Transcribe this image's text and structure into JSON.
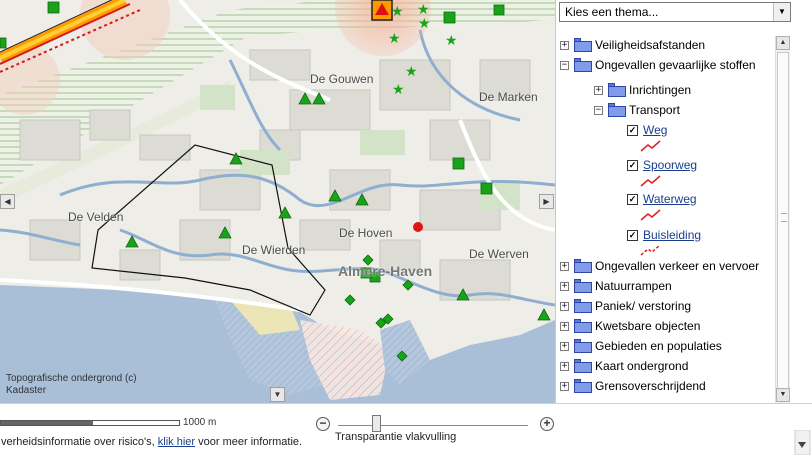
{
  "map": {
    "places": [
      {
        "id": "gouwen",
        "label": "De Gouwen"
      },
      {
        "id": "marken",
        "label": "De Marken"
      },
      {
        "id": "velden",
        "label": "De Velden"
      },
      {
        "id": "wierden",
        "label": "De Wierden"
      },
      {
        "id": "hoven",
        "label": "De Hoven"
      },
      {
        "id": "werven",
        "label": "De Werven"
      },
      {
        "id": "haven",
        "label": "Almere-Haven"
      }
    ],
    "attribution": "Topografische ondergrond (c) Kadaster",
    "colors": {
      "marker": "#1aa31a",
      "incident": "#e01515",
      "risk_zone": "#f7b8a0",
      "water": "#7aa2c9",
      "boundary": "#000000"
    }
  },
  "panel": {
    "theme_select": {
      "value": "Kies een thema...",
      "arrow_icon": "chevron-down-icon"
    },
    "tree": [
      {
        "id": "veiligheid",
        "label": "Veiligheidsafstanden",
        "expander": "+",
        "level": 0
      },
      {
        "id": "ongevallen_gev",
        "label": "Ongevallen gevaarlijke stoffen",
        "expander": "−",
        "level": 0
      },
      {
        "id": "inrichtingen",
        "label": "Inrichtingen",
        "expander": "+",
        "level": 1
      },
      {
        "id": "transport",
        "label": "Transport",
        "expander": "−",
        "level": 1
      },
      {
        "id": "ongevallen_verkeer",
        "label": "Ongevallen verkeer en vervoer",
        "expander": "+",
        "level": 0
      },
      {
        "id": "natuur",
        "label": "Natuurrampen",
        "expander": "+",
        "level": 0
      },
      {
        "id": "paniek",
        "label": "Paniek/ verstoring",
        "expander": "+",
        "level": 0
      },
      {
        "id": "kwetsbaar",
        "label": "Kwetsbare objecten",
        "expander": "+",
        "level": 0
      },
      {
        "id": "gebieden",
        "label": "Gebieden en populaties",
        "expander": "+",
        "level": 0
      },
      {
        "id": "kaart",
        "label": "Kaart ondergrond",
        "expander": "+",
        "level": 0
      },
      {
        "id": "grens",
        "label": "Grensoverschrijdend",
        "expander": "+",
        "level": 0
      }
    ],
    "layers": [
      {
        "id": "weg",
        "label": "Weg",
        "checked": true,
        "color": "#e02020",
        "style": "solid"
      },
      {
        "id": "spoorweg",
        "label": "Spoorweg",
        "checked": true,
        "color": "#e02020",
        "style": "solid"
      },
      {
        "id": "waterweg",
        "label": "Waterweg",
        "checked": true,
        "color": "#e02020",
        "style": "solid"
      },
      {
        "id": "buisleiding",
        "label": "Buisleiding",
        "checked": true,
        "color": "#e02020",
        "style": "dashed"
      }
    ],
    "check_mark": "✓"
  },
  "bottom": {
    "scale_label": "1000 m",
    "zoom_out": "−",
    "zoom_in": "+",
    "slider_label": "Transparantie vlakvulling",
    "slider_value": 0.2,
    "footer_prefix": "verheidsinformatie over risico's, ",
    "footer_link": "klik hier",
    "footer_suffix": " voor meer informatie."
  }
}
